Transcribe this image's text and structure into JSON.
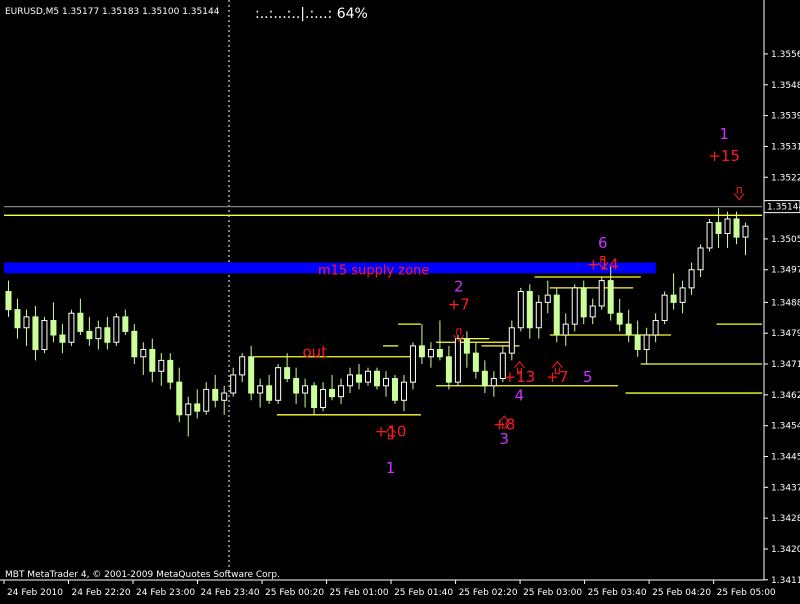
{
  "header": {
    "symbol_line": "EURUSD,M5  1.35177 1.35183 1.35100 1.35144",
    "progress_text": ":..:...:..|.:...:  64%"
  },
  "footer": {
    "copyright": "MBT MetaTrader 4, © 2001-2009 MetaQuotes Software Corp."
  },
  "colors": {
    "background": "#000000",
    "bull_candle": "#ffffff",
    "bear_candle": "#ccff99",
    "wick": "#ccff99",
    "level_line": "#ffff33",
    "supply_zone": "#0000ff",
    "annotation_red": "#ff1a1a",
    "annotation_magenta": "#cc33ff",
    "axis": "#ffffff"
  },
  "chart_data": {
    "type": "candlestick",
    "instrument": "EURUSD",
    "timeframe": "M5",
    "last_price": "1.35144",
    "ylim": [
      1.3412,
      1.3562
    ],
    "y_ticks": [
      "1.35565",
      "1.35480",
      "1.35395",
      "1.35310",
      "1.35225",
      "1.35140",
      "1.35055",
      "1.34970",
      "1.34880",
      "1.34795",
      "1.34710",
      "1.34625",
      "1.34540",
      "1.34455",
      "1.34370",
      "1.34285",
      "1.34200",
      "1.34115"
    ],
    "x_ticks": [
      "24 Feb 2010",
      "24 Feb 22:20",
      "24 Feb 23:00",
      "24 Feb 23:40",
      "25 Feb 00:20",
      "25 Feb 01:00",
      "25 Feb 01:40",
      "25 Feb 02:20",
      "25 Feb 03:00",
      "25 Feb 03:40",
      "25 Feb 04:20",
      "25 Feb 05:00"
    ],
    "candles": [
      [
        1.3491,
        1.3494,
        1.3484,
        1.3486
      ],
      [
        1.3486,
        1.3489,
        1.3478,
        1.3481
      ],
      [
        1.3481,
        1.3486,
        1.3476,
        1.3484
      ],
      [
        1.3484,
        1.3487,
        1.3472,
        1.3475
      ],
      [
        1.3475,
        1.3484,
        1.3474,
        1.3483
      ],
      [
        1.3483,
        1.3488,
        1.3477,
        1.3479
      ],
      [
        1.3479,
        1.3482,
        1.3474,
        1.3477
      ],
      [
        1.3477,
        1.3486,
        1.3476,
        1.3485
      ],
      [
        1.3485,
        1.3489,
        1.3479,
        1.348
      ],
      [
        1.348,
        1.3484,
        1.3476,
        1.3478
      ],
      [
        1.3478,
        1.3483,
        1.3475,
        1.3481
      ],
      [
        1.3481,
        1.3484,
        1.3475,
        1.3477
      ],
      [
        1.3477,
        1.3485,
        1.3476,
        1.3484
      ],
      [
        1.3484,
        1.3486,
        1.3479,
        1.348
      ],
      [
        1.348,
        1.3482,
        1.3471,
        1.3473
      ],
      [
        1.3473,
        1.3477,
        1.3468,
        1.3475
      ],
      [
        1.3475,
        1.3478,
        1.3466,
        1.3469
      ],
      [
        1.3469,
        1.3474,
        1.3465,
        1.3472
      ],
      [
        1.3472,
        1.3474,
        1.3464,
        1.3466
      ],
      [
        1.3466,
        1.347,
        1.3455,
        1.3457
      ],
      [
        1.3457,
        1.3462,
        1.3451,
        1.346
      ],
      [
        1.346,
        1.3464,
        1.3456,
        1.3458
      ],
      [
        1.3458,
        1.3466,
        1.3457,
        1.3464
      ],
      [
        1.3464,
        1.3468,
        1.3459,
        1.3461
      ],
      [
        1.3461,
        1.3465,
        1.3457,
        1.3463
      ],
      [
        1.3463,
        1.347,
        1.3462,
        1.3468
      ],
      [
        1.3468,
        1.3474,
        1.3466,
        1.3473
      ],
      [
        1.3473,
        1.3476,
        1.3461,
        1.3463
      ],
      [
        1.3463,
        1.3467,
        1.3459,
        1.3465
      ],
      [
        1.3465,
        1.3468,
        1.346,
        1.3461
      ],
      [
        1.3461,
        1.3471,
        1.346,
        1.347
      ],
      [
        1.347,
        1.3474,
        1.3466,
        1.3467
      ],
      [
        1.3467,
        1.347,
        1.346,
        1.3463
      ],
      [
        1.3463,
        1.3467,
        1.3459,
        1.3465
      ],
      [
        1.3465,
        1.3466,
        1.3457,
        1.3459
      ],
      [
        1.3459,
        1.3466,
        1.3458,
        1.3464
      ],
      [
        1.3464,
        1.3468,
        1.3461,
        1.3462
      ],
      [
        1.3462,
        1.3467,
        1.346,
        1.3465
      ],
      [
        1.3465,
        1.347,
        1.3463,
        1.3468
      ],
      [
        1.3468,
        1.3471,
        1.3464,
        1.3466
      ],
      [
        1.3466,
        1.347,
        1.3465,
        1.3469
      ],
      [
        1.3469,
        1.347,
        1.3464,
        1.3465
      ],
      [
        1.3465,
        1.3469,
        1.3462,
        1.3467
      ],
      [
        1.3467,
        1.3468,
        1.346,
        1.3461
      ],
      [
        1.3461,
        1.3468,
        1.3458,
        1.3466
      ],
      [
        1.3466,
        1.3477,
        1.3464,
        1.3476
      ],
      [
        1.3476,
        1.3482,
        1.3471,
        1.3473
      ],
      [
        1.3473,
        1.3477,
        1.347,
        1.3475
      ],
      [
        1.3475,
        1.3483,
        1.3472,
        1.3473
      ],
      [
        1.3473,
        1.3476,
        1.3464,
        1.3466
      ],
      [
        1.3466,
        1.3479,
        1.3465,
        1.3478
      ],
      [
        1.3478,
        1.348,
        1.347,
        1.3474
      ],
      [
        1.3474,
        1.3477,
        1.3467,
        1.3469
      ],
      [
        1.3469,
        1.3472,
        1.3463,
        1.3465
      ],
      [
        1.3465,
        1.3469,
        1.3462,
        1.3467
      ],
      [
        1.3467,
        1.3476,
        1.3466,
        1.3474
      ],
      [
        1.3474,
        1.3483,
        1.3472,
        1.3481
      ],
      [
        1.3481,
        1.3492,
        1.348,
        1.3491
      ],
      [
        1.3491,
        1.3493,
        1.3478,
        1.3481
      ],
      [
        1.3481,
        1.349,
        1.3478,
        1.3488
      ],
      [
        1.3488,
        1.3494,
        1.3485,
        1.349
      ],
      [
        1.349,
        1.3492,
        1.3477,
        1.3479
      ],
      [
        1.3479,
        1.3485,
        1.3476,
        1.3482
      ],
      [
        1.3482,
        1.3493,
        1.348,
        1.3492
      ],
      [
        1.3492,
        1.3494,
        1.3482,
        1.3484
      ],
      [
        1.3484,
        1.3489,
        1.3482,
        1.3487
      ],
      [
        1.3487,
        1.3495,
        1.3486,
        1.3494
      ],
      [
        1.3494,
        1.3498,
        1.3483,
        1.3485
      ],
      [
        1.3485,
        1.3489,
        1.348,
        1.3482
      ],
      [
        1.3482,
        1.3486,
        1.3477,
        1.3479
      ],
      [
        1.3479,
        1.3483,
        1.3473,
        1.3475
      ],
      [
        1.3475,
        1.3481,
        1.3471,
        1.3479
      ],
      [
        1.3479,
        1.3485,
        1.3477,
        1.3483
      ],
      [
        1.3483,
        1.3491,
        1.3482,
        1.349
      ],
      [
        1.349,
        1.3496,
        1.3486,
        1.3488
      ],
      [
        1.3488,
        1.3494,
        1.3485,
        1.3492
      ],
      [
        1.3492,
        1.3499,
        1.349,
        1.3497
      ],
      [
        1.3497,
        1.3504,
        1.3495,
        1.3503
      ],
      [
        1.3503,
        1.3511,
        1.3502,
        1.351
      ],
      [
        1.351,
        1.3514,
        1.3503,
        1.3507
      ],
      [
        1.3507,
        1.3513,
        1.3503,
        1.3511
      ],
      [
        1.3511,
        1.3513,
        1.3504,
        1.3506
      ],
      [
        1.3506,
        1.351,
        1.3501,
        1.3509
      ]
    ],
    "levels": [
      {
        "price": 1.35144,
        "from": 0,
        "to": 1,
        "color": "#808080"
      },
      {
        "price": 1.3512,
        "from": 0,
        "to": 1,
        "color": "#ffff33"
      },
      {
        "price": 1.3473,
        "from": 0.33,
        "to": 0.54,
        "color": "#ffff33"
      },
      {
        "price": 1.3457,
        "from": 0.36,
        "to": 0.55,
        "color": "#ffff33"
      },
      {
        "price": 1.3476,
        "from": 0.5,
        "to": 0.52,
        "color": "#ffff33"
      },
      {
        "price": 1.3482,
        "from": 0.52,
        "to": 0.55,
        "color": "#ffff33"
      },
      {
        "price": 1.3477,
        "from": 0.57,
        "to": 0.67,
        "color": "#ffff33"
      },
      {
        "price": 1.3478,
        "from": 0.6,
        "to": 0.64,
        "color": "#ffff33"
      },
      {
        "price": 1.3465,
        "from": 0.57,
        "to": 0.81,
        "color": "#ffff33"
      },
      {
        "price": 1.3476,
        "from": 0.63,
        "to": 0.68,
        "color": "#ffff33"
      },
      {
        "price": 1.3495,
        "from": 0.7,
        "to": 0.84,
        "color": "#ffff33"
      },
      {
        "price": 1.3492,
        "from": 0.72,
        "to": 0.83,
        "color": "#ffff33"
      },
      {
        "price": 1.3479,
        "from": 0.72,
        "to": 0.88,
        "color": "#ffff33"
      },
      {
        "price": 1.3471,
        "from": 0.84,
        "to": 1.0,
        "color": "#ffff33"
      },
      {
        "price": 1.3463,
        "from": 0.82,
        "to": 1.0,
        "color": "#ffff33"
      },
      {
        "price": 1.3482,
        "from": 0.94,
        "to": 1.0,
        "color": "#ffff33"
      }
    ],
    "zone": {
      "label": "m15 supply zone",
      "low": 1.3496,
      "high": 1.3499
    },
    "annotations": [
      {
        "text": "out",
        "kind": "red",
        "price": 1.3473,
        "at": 0.41
      },
      {
        "text": "+10",
        "kind": "red",
        "price": 1.3451,
        "at": 0.51
      },
      {
        "text": "1",
        "kind": "mag",
        "price": 1.3441,
        "at": 0.51
      },
      {
        "text": "2",
        "kind": "mag",
        "price": 1.3491,
        "at": 0.6
      },
      {
        "text": "+7",
        "kind": "red",
        "price": 1.3486,
        "at": 0.6
      },
      {
        "text": "+8",
        "kind": "red",
        "price": 1.3453,
        "at": 0.66
      },
      {
        "text": "3",
        "kind": "mag",
        "price": 1.3449,
        "at": 0.66
      },
      {
        "text": "4",
        "kind": "mag",
        "price": 1.3461,
        "at": 0.68
      },
      {
        "text": "+13",
        "kind": "red",
        "price": 1.3466,
        "at": 0.68
      },
      {
        "text": "+7",
        "kind": "red",
        "price": 1.3466,
        "at": 0.73
      },
      {
        "text": "5",
        "kind": "mag",
        "price": 1.3466,
        "at": 0.77
      },
      {
        "text": "6",
        "kind": "mag",
        "price": 1.3503,
        "at": 0.79
      },
      {
        "text": "+14",
        "kind": "red",
        "price": 1.3497,
        "at": 0.79
      },
      {
        "text": "1",
        "kind": "mag",
        "price": 1.3533,
        "at": 0.95
      },
      {
        "text": "+15",
        "kind": "red",
        "price": 1.3527,
        "at": 0.95
      }
    ],
    "arrows": [
      {
        "dir": "down",
        "price": 1.3479,
        "at": 0.6
      },
      {
        "dir": "up",
        "price": 1.3452,
        "at": 0.51
      },
      {
        "dir": "up",
        "price": 1.3455,
        "at": 0.66
      },
      {
        "dir": "up",
        "price": 1.347,
        "at": 0.68
      },
      {
        "dir": "up",
        "price": 1.347,
        "at": 0.73
      },
      {
        "dir": "down",
        "price": 1.3499,
        "at": 0.79
      },
      {
        "dir": "down",
        "price": 1.3518,
        "at": 0.97
      }
    ]
  }
}
